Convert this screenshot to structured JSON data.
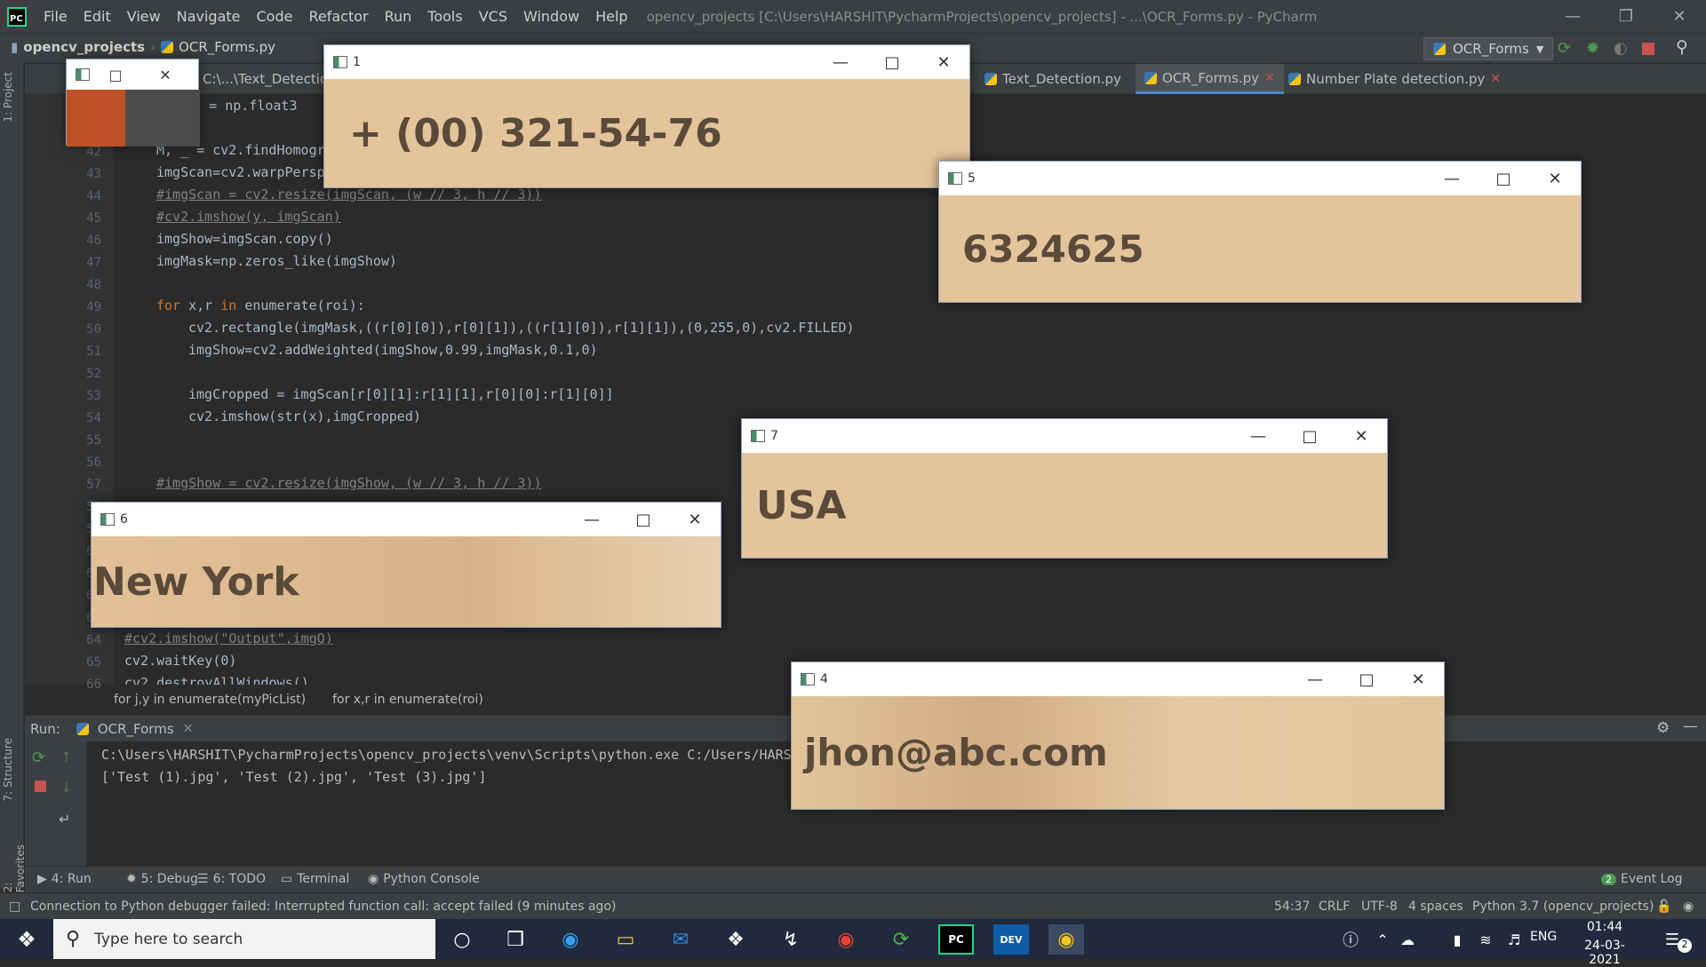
{
  "menubar": {
    "items": [
      "File",
      "Edit",
      "View",
      "Navigate",
      "Code",
      "Refactor",
      "Run",
      "Tools",
      "VCS",
      "Window",
      "Help"
    ],
    "title": "opencv_projects [C:\\Users\\HARSHIT\\PycharmProjects\\opencv_projects] - ...\\OCR_Forms.py - PyCharm"
  },
  "navbar": {
    "project": "opencv_projects",
    "file": "OCR_Forms.py",
    "run_config": "OCR_Forms"
  },
  "side_tabs": {
    "project": "1: Project",
    "structure": "7: Structure",
    "favorites": "2: Favorites"
  },
  "tabs": [
    {
      "label": "C:\\...\\Text_Detection"
    },
    {
      "label": "Text_Detection.py"
    },
    {
      "label": "OCR_Forms.py"
    },
    {
      "label": "Number Plate detection.py"
    }
  ],
  "editor": {
    "line_numbers": [
      "42",
      "43",
      "44",
      "45",
      "46",
      "47",
      "48",
      "49",
      "50",
      "51",
      "52",
      "53",
      "54",
      "55",
      "56",
      "57",
      "58",
      "59",
      "60",
      "61",
      "62",
      "63",
      "64",
      "65",
      "66"
    ],
    "lines": {
      "l41": "ints = np.float3",
      "l42": "M, _ = cv2.findHomogr",
      "l43": "imgScan=cv2.warpPersp",
      "l44": "#imgScan = cv2.resize(imgScan, (w // 3, h // 3))",
      "l45": "#cv2.imshow(y, imgScan)",
      "l46": "imgShow=imgScan.copy()",
      "l47": "imgMask=np.zeros_like(imgShow)",
      "l49a": "for ",
      "l49b": "x,r ",
      "l49c": "in ",
      "l49d": "enumerate(roi):",
      "l50": "cv2.rectangle(imgMask,((r[0][0]),r[0][1]),((r[1][0]),r[1][1]),(0,255,0),cv2.FILLED)",
      "l51": "imgShow=cv2.addWeighted(imgShow,0.99,imgMask,0.1,0)",
      "l53": "imgCropped = imgScan[r[0][1]:r[1][1],r[0][0]:r[1][0]]",
      "l54": "cv2.imshow(str(x),imgCropped)",
      "l57": "#imgShow = cv2.resize(imgShow, (w // 3, h // 3))",
      "l64": "#cv2.imshow(\"Output\",imgQ)",
      "l65": "cv2.waitKey(0)",
      "l66": "cv2.destroyAllWindows()"
    },
    "breadcrumb": [
      "for j,y in enumerate(myPicList)",
      "for x,r in enumerate(roi)"
    ]
  },
  "run_panel": {
    "label": "Run:",
    "tab": "OCR_Forms",
    "console": [
      "C:\\Users\\HARSHIT\\PycharmProjects\\opencv_projects\\venv\\Scripts\\python.exe C:/Users/HARSH",
      "['Test (1).jpg', 'Test (2).jpg', 'Test (3).jpg']"
    ]
  },
  "tool_windows": {
    "run": "4: Run",
    "debug": "5: Debug",
    "todo": "6: TODO",
    "terminal": "Terminal",
    "python_console": "Python Console",
    "event_log": "Event Log",
    "event_count": "2"
  },
  "statusbar": {
    "message": "Connection to Python debugger failed: Interrupted function call: accept failed (9 minutes ago)",
    "position": "54:37",
    "line_sep": "CRLF",
    "encoding": "UTF-8",
    "indent": "4 spaces",
    "interpreter": "Python 3.7 (opencv_projects)"
  },
  "cv_windows": [
    {
      "title": "1",
      "text": "+ (00) 321-54-76"
    },
    {
      "title": "5",
      "text": "6324625"
    },
    {
      "title": "7",
      "text": "USA"
    },
    {
      "title": "6",
      "text": "New York"
    },
    {
      "title": "4",
      "text": "jhon@abc.com"
    },
    {
      "title": ""
    }
  ],
  "taskbar": {
    "search_placeholder": "Type here to search",
    "lang": "ENG",
    "time": "01:44",
    "date": "24-03-2021",
    "notifications": "2"
  },
  "colors": {
    "accent": "#4a88c7",
    "crop_bg": "#e4c49b",
    "run_green": "#499c54",
    "stop_red": "#c75450"
  }
}
